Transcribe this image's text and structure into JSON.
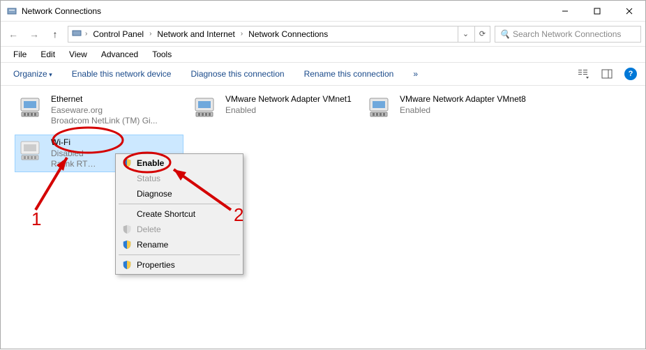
{
  "window": {
    "title": "Network Connections"
  },
  "breadcrumbs": {
    "root_sep": "›",
    "c1": "Control Panel",
    "c2": "Network and Internet",
    "c3": "Network Connections"
  },
  "search": {
    "placeholder": "Search Network Connections"
  },
  "menubar": {
    "file": "File",
    "edit": "Edit",
    "view": "View",
    "advanced": "Advanced",
    "tools": "Tools"
  },
  "cmdbar": {
    "organize": "Organize",
    "enable": "Enable this network device",
    "diagnose": "Diagnose this connection",
    "rename": "Rename this connection",
    "overflow": "»"
  },
  "adapters": [
    {
      "name": "Ethernet",
      "status": "Easeware.org",
      "device": "Broadcom NetLink (TM) Gi...",
      "disabled": false
    },
    {
      "name": "VMware Network Adapter VMnet1",
      "status": "Enabled",
      "device": "",
      "disabled": false
    },
    {
      "name": "VMware Network Adapter VMnet8",
      "status": "Enabled",
      "device": "",
      "disabled": false
    },
    {
      "name": "Wi-Fi",
      "status": "Disabled",
      "device": "Ralink RT…",
      "disabled": true
    }
  ],
  "context_menu": {
    "enable": "Enable",
    "status": "Status",
    "diagnose": "Diagnose",
    "create_shortcut": "Create Shortcut",
    "delete": "Delete",
    "rename": "Rename",
    "properties": "Properties"
  },
  "annotations": {
    "label1": "1",
    "label2": "2"
  }
}
